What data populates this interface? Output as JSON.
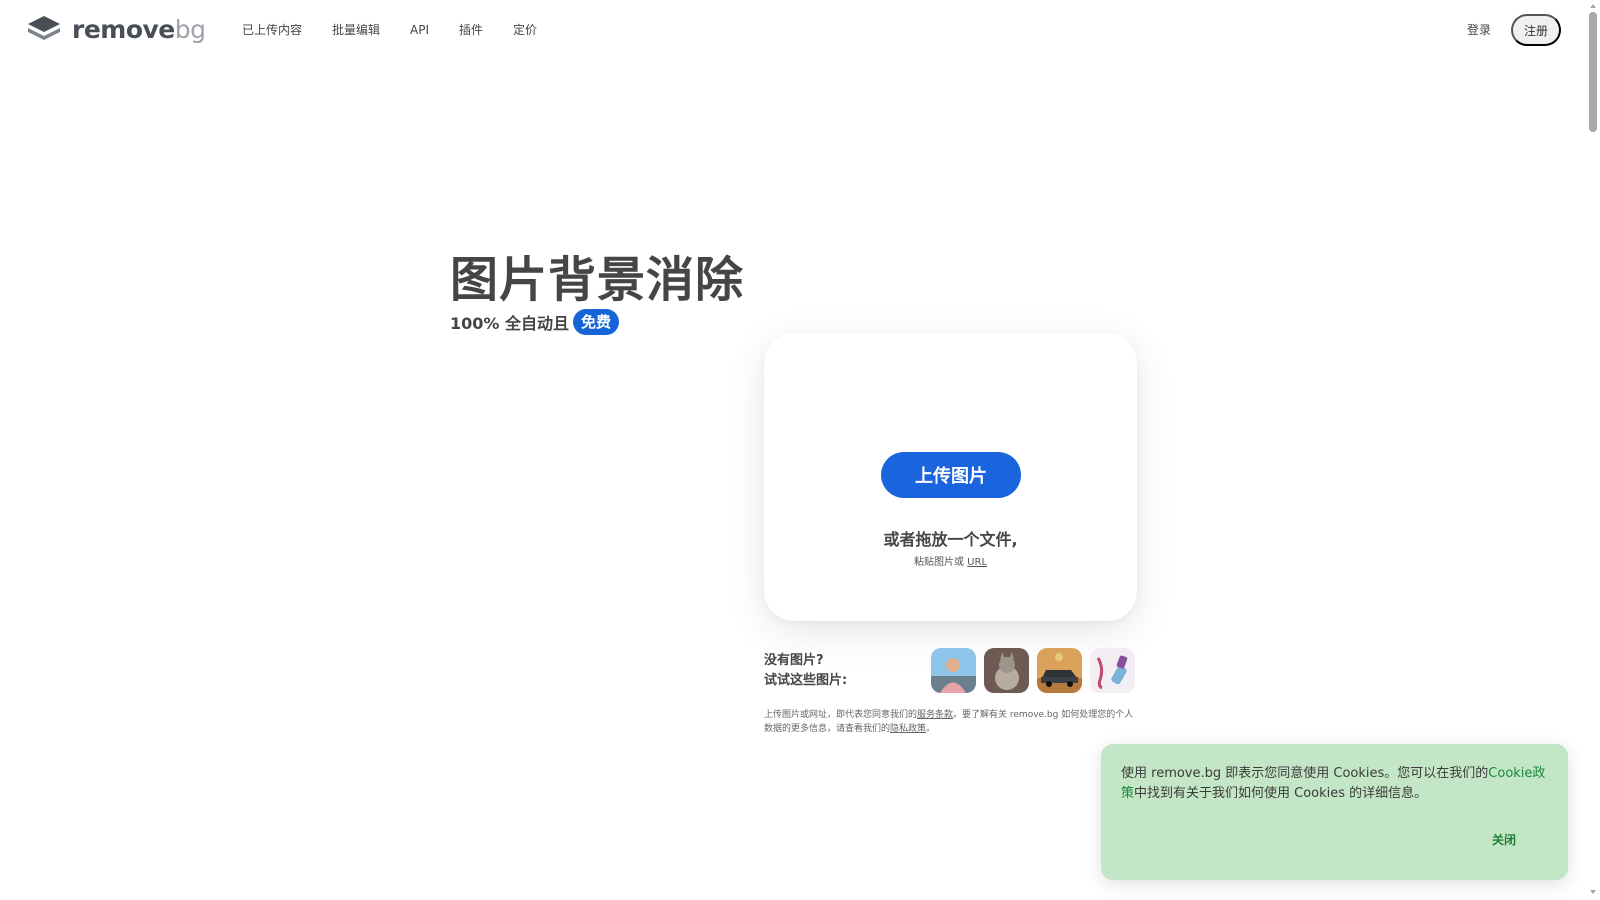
{
  "header": {
    "logo_text_main": "remove",
    "logo_text_bg": "bg",
    "nav": [
      {
        "label": "已上传内容"
      },
      {
        "label": "批量编辑"
      },
      {
        "label": "API"
      },
      {
        "label": "插件"
      },
      {
        "label": "定价"
      }
    ],
    "login_label": "登录",
    "signup_label": "注册"
  },
  "hero": {
    "title": "图片背景消除",
    "subtitle": "100% 全自动且",
    "badge": "免费"
  },
  "upload": {
    "button_label": "上传图片",
    "drop_text": "或者拖放一个文件,",
    "paste_text": "粘贴图片或 ",
    "paste_url": "URL"
  },
  "samples": {
    "label_line1": "没有图片?",
    "label_line2": "试试这些图片:",
    "items": [
      {
        "icon": "person-sample-icon"
      },
      {
        "icon": "cat-sample-icon"
      },
      {
        "icon": "car-sample-icon"
      },
      {
        "icon": "product-sample-icon"
      }
    ]
  },
  "legal": {
    "part1": "上传图片或网址，即代表您同意我们的",
    "terms": "服务条款",
    "part2": "。要了解有关 remove.bg 如何处理您的个人数据的更多信息，请查看我们的",
    "privacy": "隐私政策",
    "part3": "。"
  },
  "cookie": {
    "text_before": "使用 remove.bg 即表示您同意使用 Cookies。您可以在我们的",
    "policy_link": "Cookie政策",
    "text_after": "中找到有关于我们如何使用 Cookies 的详细信息。",
    "close_label": "关闭"
  },
  "colors": {
    "accent": "#1a65dd",
    "cookie_bg": "#c3e6c6",
    "cookie_link": "#1c8a3a"
  }
}
